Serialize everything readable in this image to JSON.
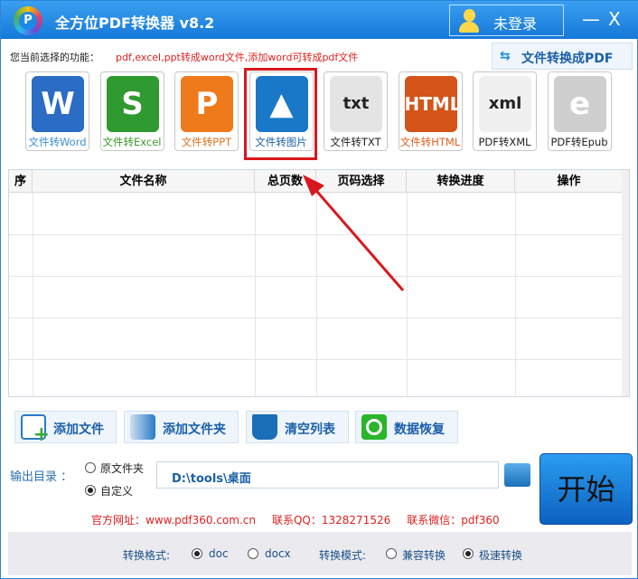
{
  "app": {
    "logo_letter": "P",
    "title": "全方位PDF转换器 v8.2",
    "login": "未登录",
    "minimize": "—",
    "close": "X"
  },
  "function": {
    "label": "您当前选择的功能：",
    "desc": "pdf,excel,ppt转成word文件,添加word可转成pdf文件",
    "to_pdf": "文件转换成PDF",
    "to_pdf_icon": "⇆"
  },
  "tools": [
    {
      "label": "文件转Word",
      "glyph": "W",
      "color": "#2b6cc4",
      "text": "#3a8fd8"
    },
    {
      "label": "文件转Excel",
      "glyph": "S",
      "color": "#2f9a2f",
      "text": "#3a9a2a"
    },
    {
      "label": "文件转PPT",
      "glyph": "P",
      "color": "#ee7a1c",
      "text": "#e07020"
    },
    {
      "label": "文件转图片",
      "glyph": "▲",
      "color": "#1a78c8",
      "text": "#1a5fa8"
    },
    {
      "label": "文件转TXT",
      "glyph": "txt",
      "color": "#e4e4e4",
      "text": "#222"
    },
    {
      "label": "文件转HTML",
      "glyph": "HTML",
      "color": "#d4541a",
      "text": "#e06020"
    },
    {
      "label": "PDF转XML",
      "glyph": "xml",
      "color": "#f0f0f0",
      "text": "#222"
    },
    {
      "label": "PDF转Epub",
      "glyph": "e",
      "color": "#cfcfcf",
      "text": "#222"
    }
  ],
  "table": {
    "columns": [
      "序",
      "文件名称",
      "总页数",
      "页码选择",
      "转换进度",
      "操作"
    ]
  },
  "actions": [
    "添加文件",
    "添加文件夹",
    "清空列表",
    "数据恢复"
  ],
  "output": {
    "label": "输出目录 ：",
    "options": [
      "原文件夹",
      "自定义"
    ],
    "selected": "自定义",
    "path": "D:\\tools\\桌面",
    "start": "开始"
  },
  "contact": {
    "site": "官方网址：www.pdf360.com.cn",
    "qq": "联系QQ：1328271526",
    "wechat": "联系微信：pdf360"
  },
  "bottom": {
    "format_label": "转换格式:",
    "formats": [
      "doc",
      "docx"
    ],
    "format_selected": "doc",
    "mode_label": "转换模式:",
    "modes": [
      "兼容转换",
      "极速转换"
    ],
    "mode_selected": "极速转换"
  }
}
